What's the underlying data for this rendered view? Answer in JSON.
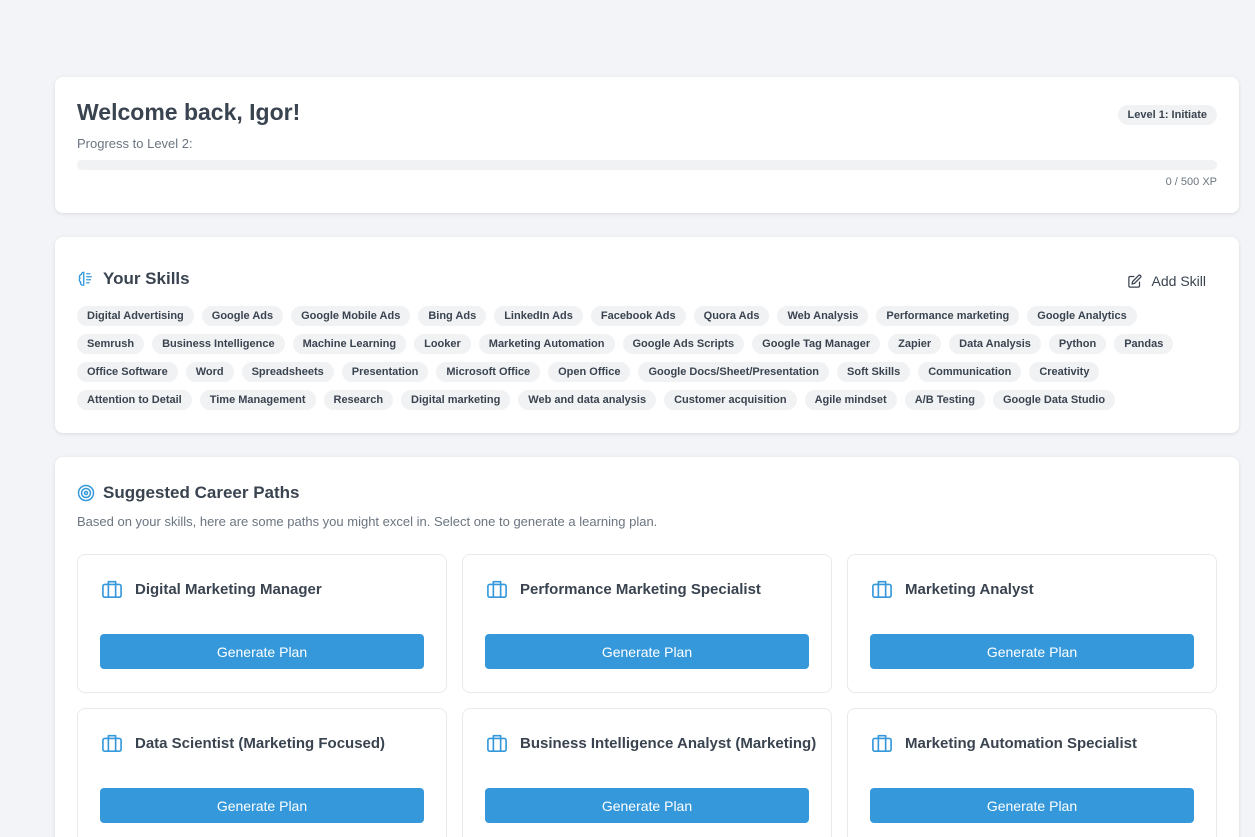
{
  "welcome": {
    "title": "Welcome back, Igor!",
    "level_badge": "Level 1: Initiate",
    "progress_label": "Progress to Level 2:",
    "xp_text": "0 / 500 XP",
    "progress_fraction": 0
  },
  "skills": {
    "heading": "Your Skills",
    "add_label": "Add Skill",
    "items": [
      "Digital Advertising",
      "Google Ads",
      "Google Mobile Ads",
      "Bing Ads",
      "LinkedIn Ads",
      "Facebook Ads",
      "Quora Ads",
      "Web Analysis",
      "Performance marketing",
      "Google Analytics",
      "Semrush",
      "Business Intelligence",
      "Machine Learning",
      "Looker",
      "Marketing Automation",
      "Google Ads Scripts",
      "Google Tag Manager",
      "Zapier",
      "Data Analysis",
      "Python",
      "Pandas",
      "Office Software",
      "Word",
      "Spreadsheets",
      "Presentation",
      "Microsoft Office",
      "Open Office",
      "Google Docs/Sheet/Presentation",
      "Soft Skills",
      "Communication",
      "Creativity",
      "Attention to Detail",
      "Time Management",
      "Research",
      "Digital marketing",
      "Web and data analysis",
      "Customer acquisition",
      "Agile mindset",
      "A/B Testing",
      "Google Data Studio"
    ]
  },
  "career": {
    "heading": "Suggested Career Paths",
    "subtitle": "Based on your skills, here are some paths you might excel in. Select one to generate a learning plan.",
    "button_label": "Generate Plan",
    "paths": [
      {
        "title": "Digital Marketing Manager"
      },
      {
        "title": "Performance Marketing Specialist"
      },
      {
        "title": "Marketing Analyst"
      },
      {
        "title": "Data Scientist (Marketing Focused)"
      },
      {
        "title": "Business Intelligence Analyst (Marketing)"
      },
      {
        "title": "Marketing Automation Specialist"
      }
    ]
  },
  "colors": {
    "accent": "#3498db",
    "page_bg": "#f2f4f7",
    "chip_bg": "#f1f2f4"
  },
  "icons": {
    "skills": "brain-icon",
    "add": "edit-icon",
    "career": "target-icon",
    "path": "briefcase-icon"
  }
}
